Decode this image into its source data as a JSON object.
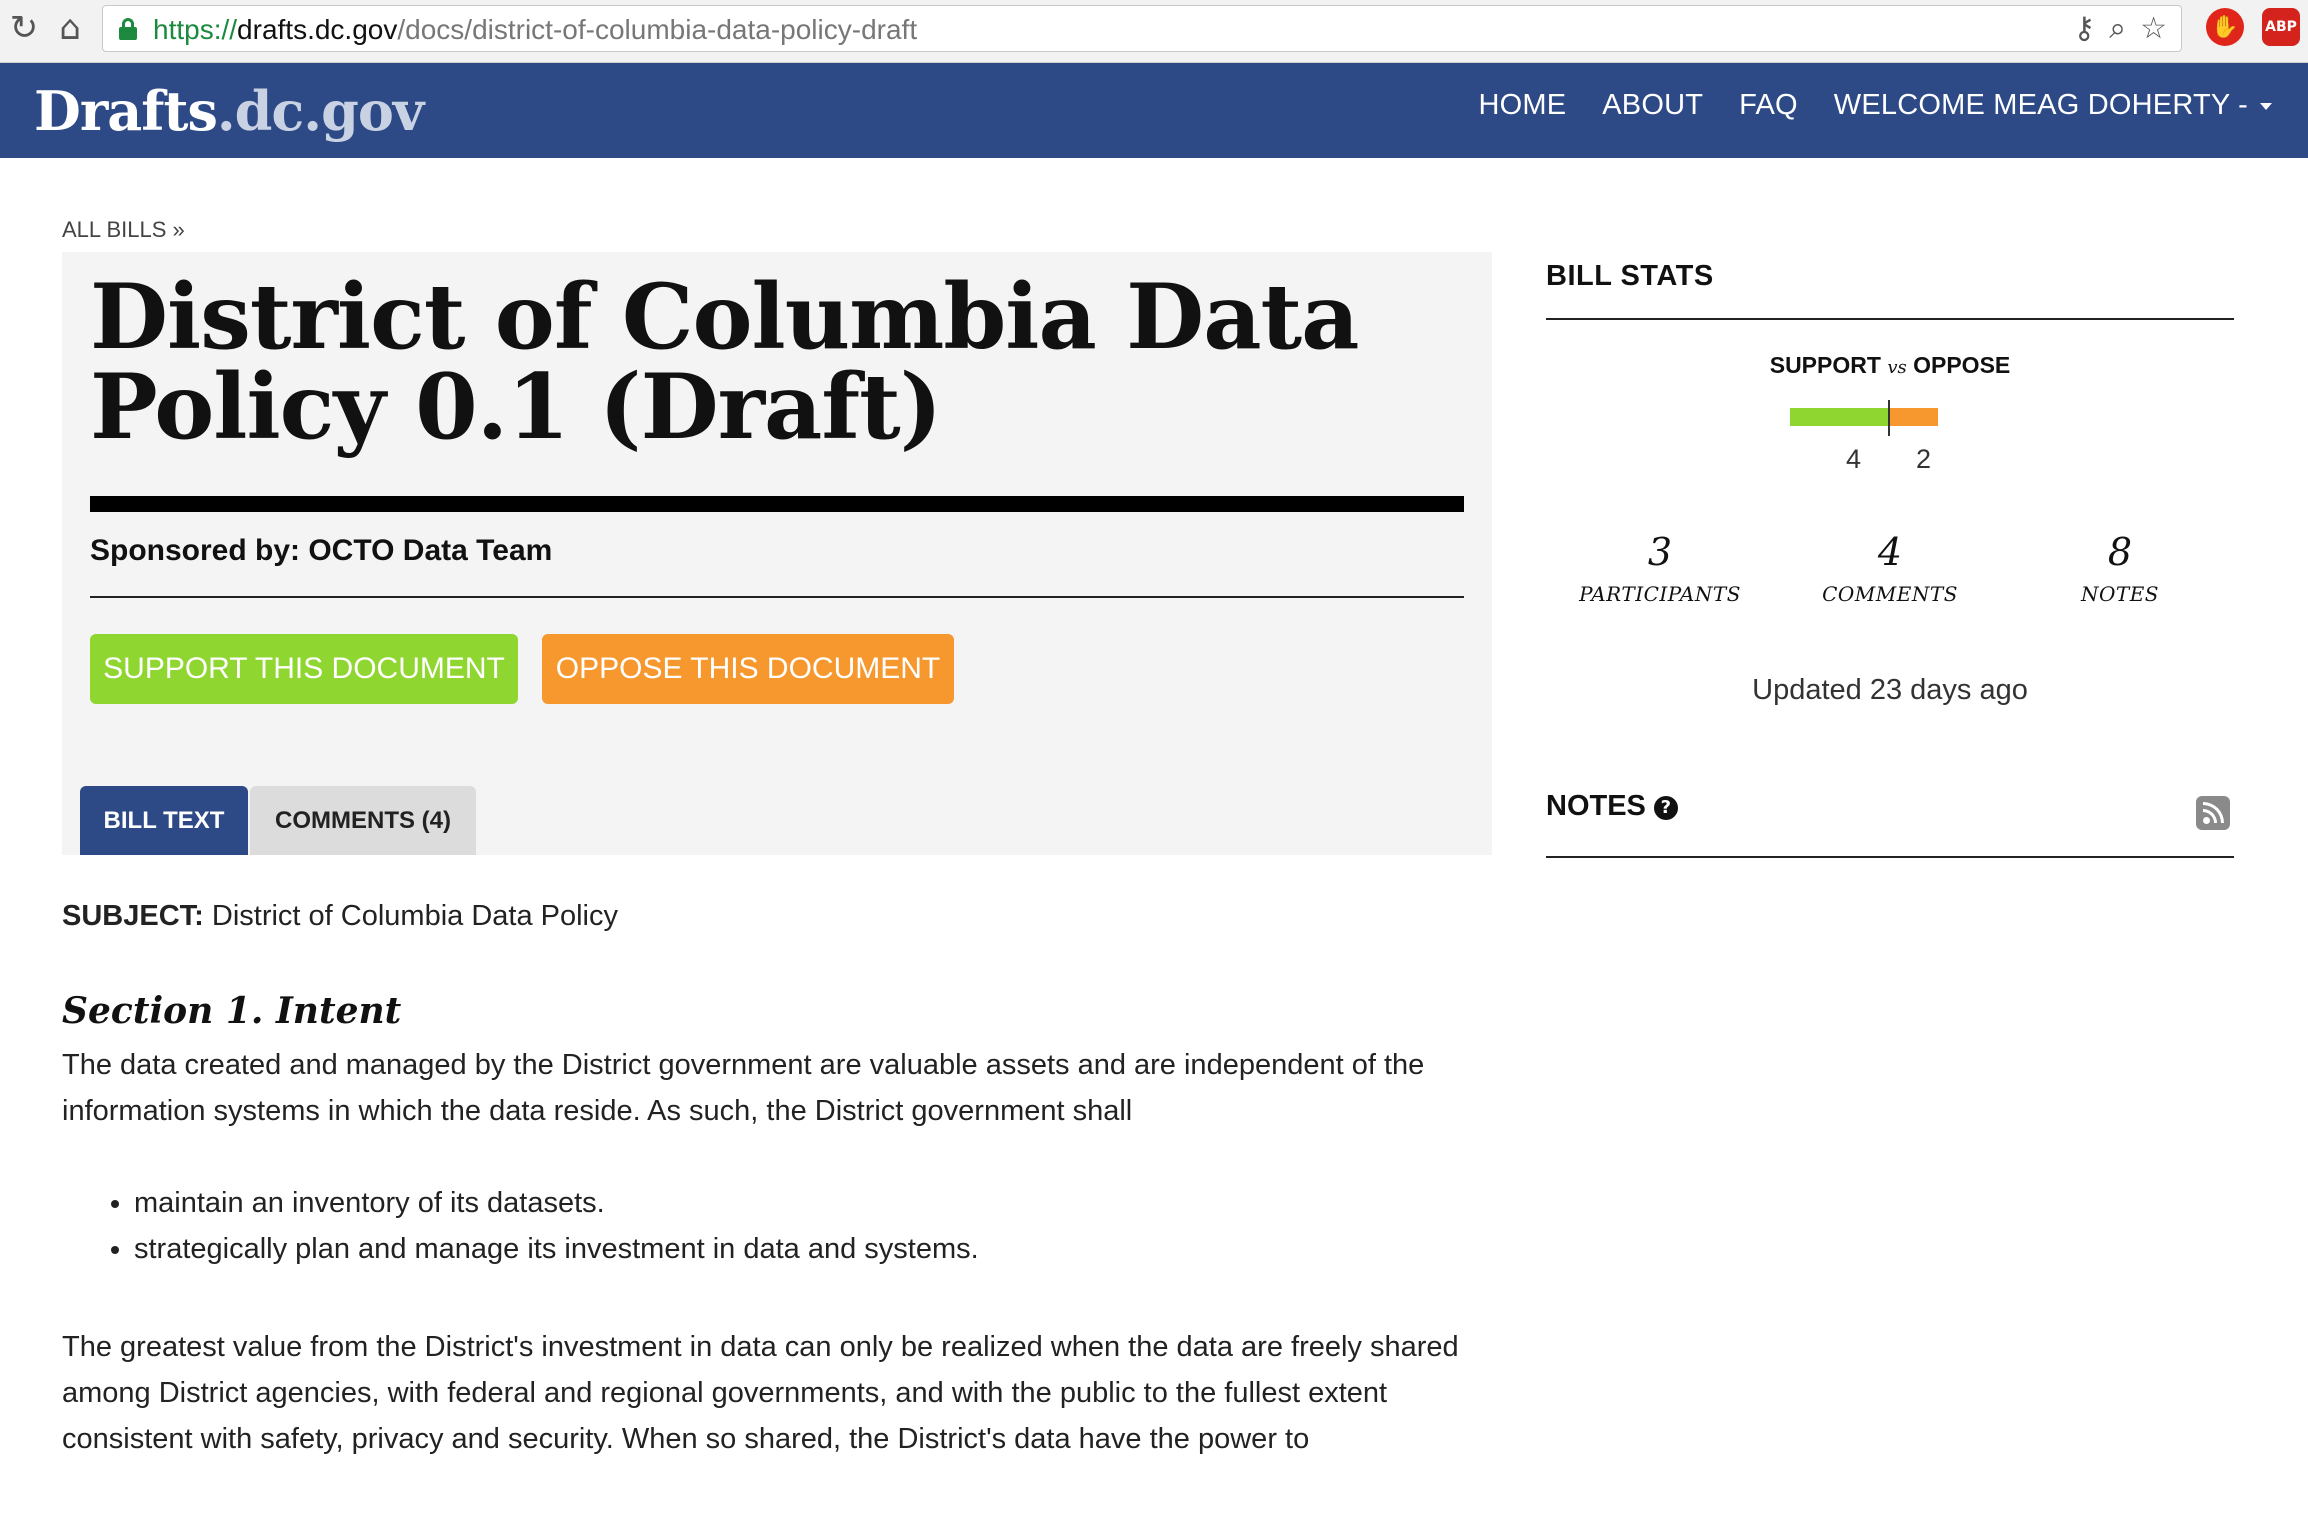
{
  "browser": {
    "url_scheme": "https://",
    "url_host": "drafts.dc.gov",
    "url_path": "/docs/district-of-columbia-data-policy-draft",
    "reload_icon": "reload-icon",
    "home_icon": "home-icon",
    "ext_abp_label": "ABP"
  },
  "header": {
    "logo_part1": "Drafts",
    "logo_part2": ".dc.gov",
    "nav": {
      "home": "HOME",
      "about": "ABOUT",
      "faq": "FAQ",
      "welcome": "WELCOME MEAG DOHERTY -"
    },
    "colors": {
      "bar": "#2d4a87"
    }
  },
  "main": {
    "breadcrumb": "ALL BILLS »",
    "title": "District of Columbia Data Policy 0.1 (Draft)",
    "sponsor": "Sponsored by: OCTO Data Team",
    "support_button": "SUPPORT THIS DOCUMENT",
    "oppose_button": "OPPOSE THIS DOCUMENT",
    "tabs": {
      "bill_text": "BILL TEXT",
      "comments": "COMMENTS (4)"
    },
    "subject_label": "SUBJECT:",
    "subject_value": "District of Columbia Data Policy",
    "section_heading": "Section 1. Intent",
    "paragraph1": "The data created and managed by the District government are valuable assets and are independent of the information systems in which the data reside. As such, the District government shall",
    "bullets": [
      "maintain an inventory of its datasets.",
      "strategically plan and manage its investment in data and systems."
    ],
    "paragraph2": "The greatest value from the District's investment in data can only be realized when the data are freely shared among District agencies, with federal and regional governments, and with the public to the fullest extent consistent with safety, privacy and security. When so shared, the District's data have the power to",
    "colors": {
      "support": "#8fd630",
      "oppose": "#f7982e"
    }
  },
  "sidebar": {
    "bill_stats_heading": "BILL STATS",
    "svo_support": "SUPPORT",
    "svo_vs": "vs",
    "svo_oppose": "OPPOSE",
    "support_count": "4",
    "oppose_count": "2",
    "support_value": 4,
    "oppose_value": 2,
    "participants_count": "3",
    "participants_label": "PARTICIPANTS",
    "comments_count": "4",
    "comments_label": "COMMENTS",
    "notes_count": "8",
    "notes_label": "NOTES",
    "updated": "Updated 23 days ago",
    "notes_heading": "NOTES",
    "help_icon": "question-circle-icon",
    "rss_icon": "rss-icon"
  }
}
